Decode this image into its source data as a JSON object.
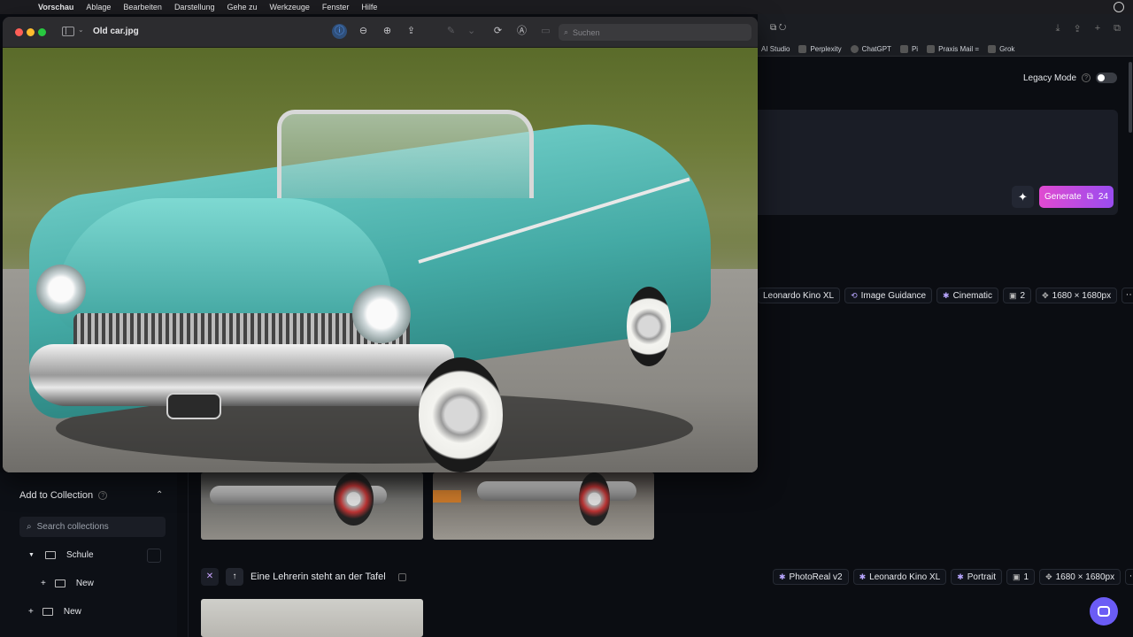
{
  "menubar": {
    "apple": "",
    "items": [
      "Vorschau",
      "Ablage",
      "Bearbeiten",
      "Darstellung",
      "Gehe zu",
      "Werkzeuge",
      "Fenster",
      "Hilfe"
    ]
  },
  "bookmarks": [
    "AI Studio",
    "Perplexity",
    "ChatGPT",
    "Pi",
    "Praxis Mail =",
    "Grok"
  ],
  "app": {
    "legacy_mode_label": "Legacy Mode",
    "generate_label": "Generate",
    "generate_cost": "24",
    "row1_tags": [
      "Leonardo Kino XL",
      "Image Guidance",
      "Cinematic",
      "2",
      "1680 × 1680px"
    ],
    "row2_tags": [
      "PhotoReal v2",
      "Leonardo Kino XL",
      "Portrait",
      "1",
      "1680 × 1680px"
    ],
    "prompt_text": "Eine Lehrerin steht an der Tafel",
    "more_label": "···"
  },
  "sidebar": {
    "collection_title": "Add to Collection",
    "search_placeholder": "Search collections",
    "tree": [
      {
        "label": "Schule"
      },
      {
        "label": "New"
      },
      {
        "label": "New"
      }
    ]
  },
  "preview": {
    "file_title": "Old car.jpg",
    "search_placeholder": "Suchen",
    "icons": [
      "info-icon",
      "zoom-out-icon",
      "zoom-in-icon",
      "share-icon",
      "markup-icon",
      "rotate-icon",
      "annotate-icon",
      "form-icon"
    ]
  }
}
